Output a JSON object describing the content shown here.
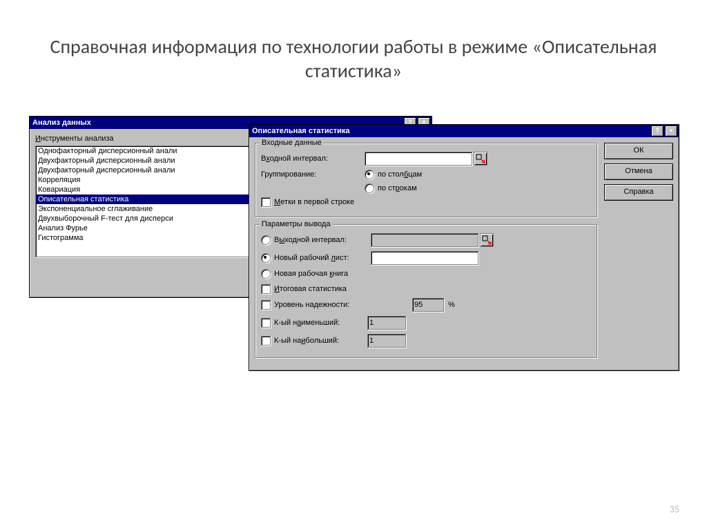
{
  "slide_title": "Справочная информация по технологии работы в режиме «Описательная статистика»",
  "page_number": "35",
  "dialog1": {
    "title": "Анализ данных",
    "tools_label": "Инструменты анализа",
    "items": [
      "Однофакторный дисперсионный анали",
      "Двухфакторный дисперсионный анали",
      "Двухфакторный дисперсионный анали",
      "Корреляция",
      "Ковариация",
      "Описательная статистика",
      "Экспоненциальное сглаживание",
      "Двухвыборочный F-тест для дисперси",
      "Анализ Фурье",
      "Гистограмма"
    ],
    "selected_index": 5
  },
  "dialog2": {
    "title": "Описательная статистика",
    "buttons": {
      "ok": "ОК",
      "cancel": "Отмена",
      "help": "Справка"
    },
    "input_group": {
      "title": "Входные данные",
      "range_label": "Входной интервал:",
      "range_value": "",
      "grouping_label": "Группирование:",
      "by_columns": "по столбцам",
      "by_rows": "по строкам",
      "grouping_selected": "columns",
      "labels_first_row": "Метки в первой строке"
    },
    "output_group": {
      "title": "Параметры вывода",
      "out_range": "Выходной интервал:",
      "new_sheet": "Новый рабочий лист:",
      "new_book": "Новая рабочая книга",
      "selected": "new_sheet",
      "out_range_value": "",
      "new_sheet_value": "",
      "summary": "Итоговая статистика",
      "confidence": "Уровень надежности:",
      "confidence_value": "95",
      "confidence_unit": "%",
      "kth_smallest": "К-ый наименьший:",
      "kth_smallest_value": "1",
      "kth_largest": "К-ый наибольший:",
      "kth_largest_value": "1"
    }
  }
}
